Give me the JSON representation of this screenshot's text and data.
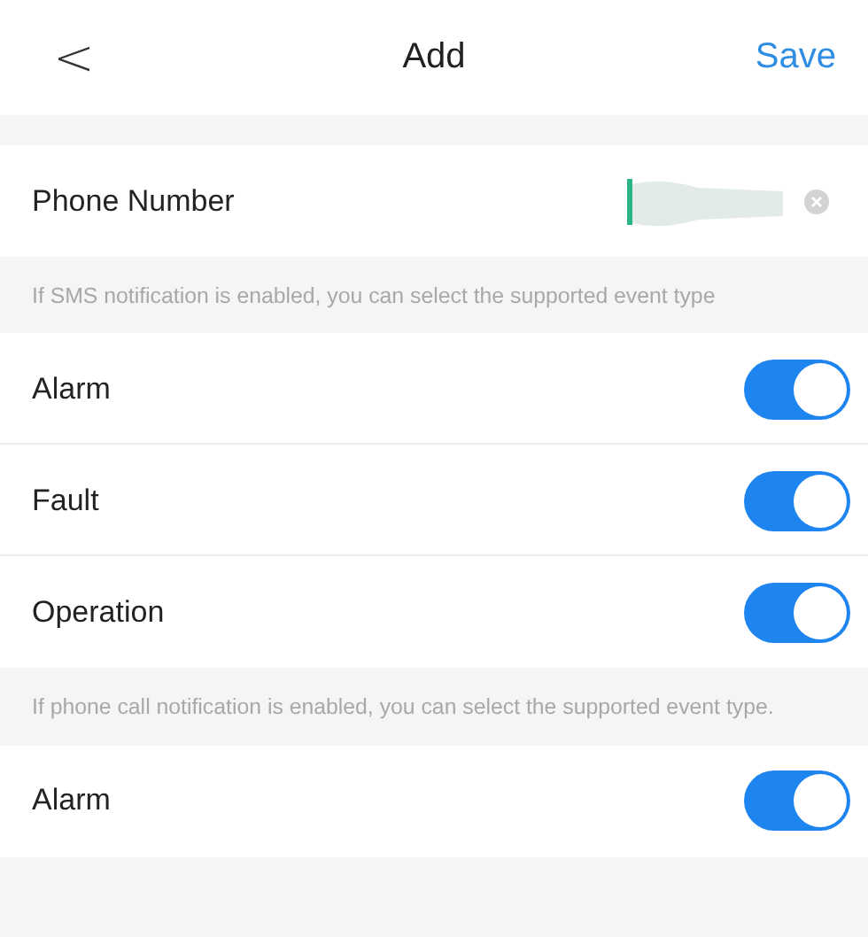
{
  "header": {
    "back": "<",
    "title": "Add",
    "action": "Save"
  },
  "phone": {
    "label": "Phone Number",
    "value_redacted": true
  },
  "sections": [
    {
      "note": "If SMS notification is enabled, you can select the supported event type",
      "items": [
        {
          "label": "Alarm",
          "on": true
        },
        {
          "label": "Fault",
          "on": true
        },
        {
          "label": "Operation",
          "on": true
        }
      ]
    },
    {
      "note": "If phone call notification is enabled, you can select the supported event type.",
      "items": [
        {
          "label": "Alarm",
          "on": true
        }
      ]
    }
  ]
}
